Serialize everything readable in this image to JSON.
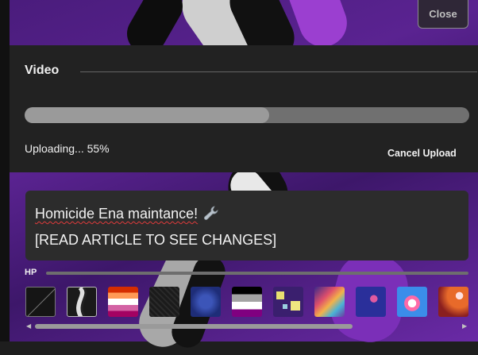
{
  "window": {
    "close_label": "Close"
  },
  "video": {
    "title": "Video",
    "progress_fraction": 0.55,
    "status": "Uploading... 55%",
    "cancel_label": "Cancel Upload"
  },
  "message": {
    "line1": "Homicide Ena maintance!",
    "line1_icon": "wrench-icon",
    "line2": "[READ ARTICLE TO SEE CHANGES]"
  },
  "hp": {
    "label": "HP"
  },
  "swatches": [
    {
      "name": "none-swatch"
    },
    {
      "name": "wave-swatch"
    },
    {
      "name": "lesbian-flag-swatch"
    },
    {
      "name": "dark-texture-swatch"
    },
    {
      "name": "blue-circuit-swatch"
    },
    {
      "name": "ace-flag-swatch"
    },
    {
      "name": "cubes-swatch"
    },
    {
      "name": "rainbow-waves-swatch"
    },
    {
      "name": "space-swatch"
    },
    {
      "name": "heart-swatch"
    },
    {
      "name": "hearts-orange-swatch"
    }
  ],
  "colors": {
    "panel": "#222222",
    "progress_track": "#707070",
    "progress_fill": "#9a9a9a",
    "spellcheck": "#e03b3b"
  }
}
